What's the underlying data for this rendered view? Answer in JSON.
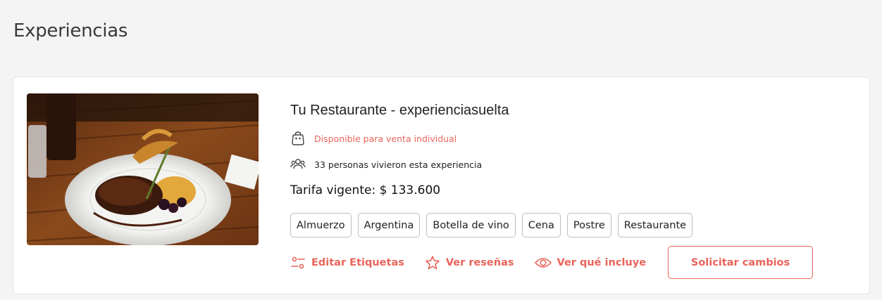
{
  "page": {
    "title": "Experiencias"
  },
  "experience": {
    "title": "Tu Restaurante - experienciasuelta",
    "availability": "Disponible para venta individual",
    "people": "33 personas vivieron esta experiencia",
    "price": "Tarifa vigente: $ 133.600",
    "image_alt": "Plato de carne con puré y romero",
    "tags": [
      "Almuerzo",
      "Argentina",
      "Botella de vino",
      "Cena",
      "Postre",
      "Restaurante"
    ],
    "actions": {
      "edit_tags": "Editar Etiquetas",
      "reviews": "Ver reseñas",
      "includes": "Ver qué incluye",
      "request_changes": "Solicitar cambios"
    }
  },
  "icons": {
    "availability": "shopping-bag-icon",
    "people": "users-icon",
    "edit_tags": "sliders-icon",
    "reviews": "star-icon",
    "includes": "eye-icon"
  },
  "colors": {
    "accent": "#e8645a",
    "background": "#f4f4f4",
    "card": "#ffffff"
  }
}
